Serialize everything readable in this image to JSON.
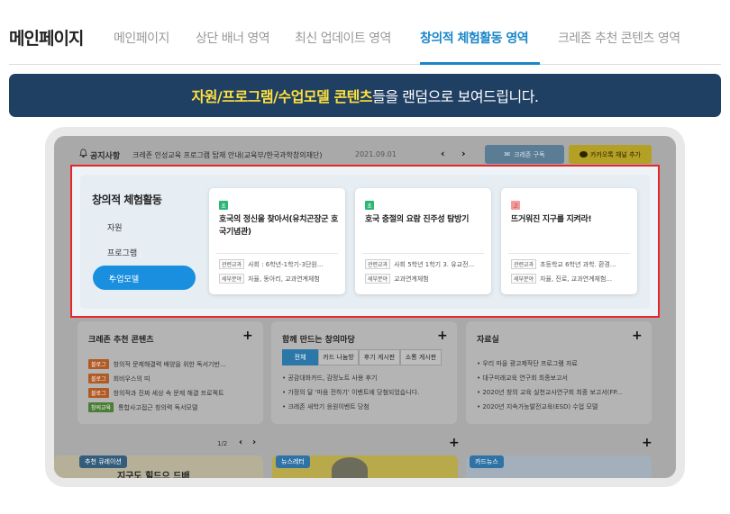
{
  "header": {
    "page_title": "메인페이지",
    "tabs": [
      {
        "label": "메인페이지"
      },
      {
        "label": "상단 배너 영역"
      },
      {
        "label": "최신 업데이트 영역"
      },
      {
        "label": "창의적 체험활동 영역"
      },
      {
        "label": "크레존 추천 콘텐츠 영역"
      }
    ],
    "active_tab_index": 3,
    "accent_color": "#1a86c8"
  },
  "banner": {
    "highlight": "자원/프로그램/수업모델 콘텐츠",
    "rest": "들을 랜덤으로 보여드립니다.",
    "bg_color": "#1f3f63",
    "highlight_color": "#ffe03d"
  },
  "preview": {
    "notice": {
      "label": "공지사항",
      "icon": "bell-icon",
      "text": "크레존 인성교육 프로그램 탑재 안내(교육부/한국과학창의재단)",
      "date": "2021.09.01",
      "subscribe_label": "크레존 구독",
      "kakao_label": "카카오톡 채널 추가"
    },
    "highlight_border_color": "#e8262a",
    "creative": {
      "title": "창의적 체험활동",
      "menu": [
        {
          "label": "자원"
        },
        {
          "label": "프로그램"
        },
        {
          "label": "수업모델"
        }
      ],
      "active_menu_index": 2,
      "cards": [
        {
          "badge": "초",
          "badge_color": "#2bb673",
          "title": "호국의 정신을 찾아서(유치곤장군 호국기념관)",
          "meta": [
            {
              "key": "관련교과",
              "value": "사회 : 6학년-1학기-3단원..."
            },
            {
              "key": "세부분야",
              "value": "자율, 동아리, 교과연계체험"
            }
          ]
        },
        {
          "badge": "초",
          "badge_color": "#2bb673",
          "title": "호국 충절의 요람 진주성 탐방기",
          "meta": [
            {
              "key": "관련교과",
              "value": "사회 5학년 1학기 3. 유교전..."
            },
            {
              "key": "세부분야",
              "value": "교과연계체험"
            }
          ]
        },
        {
          "badge": "고",
          "badge_color": "#f39b9b",
          "title": "뜨거워진 지구를 지켜라!",
          "meta": [
            {
              "key": "관련교과",
              "value": "초등학교 6학년 과학. 환경..."
            },
            {
              "key": "세부분야",
              "value": "자율, 진로, 교과연계체험..."
            }
          ]
        }
      ]
    },
    "recommend": {
      "title": "크레존 추천 콘텐츠",
      "items": [
        {
          "tag": "블로그",
          "text": "창의적 문제해결력 배양을 위한 독서기반..."
        },
        {
          "tag": "블로그",
          "text": "회비우스의 띠"
        },
        {
          "tag": "블로그",
          "text": "창의적과 진짜 세상 속 문제 해결 프로젝트"
        },
        {
          "tag": "창의교육",
          "text": "통합사고접근 창의력 독서모델"
        }
      ],
      "pager": "1/2"
    },
    "madang": {
      "title": "함께 만드는 창의마당",
      "tabs": [
        {
          "label": "전체"
        },
        {
          "label": "카드 나눔방"
        },
        {
          "label": "후기 게시판"
        },
        {
          "label": "소통 게시판"
        }
      ],
      "items": [
        {
          "text": "• 공감대화카드, 감정노트 사용 후기"
        },
        {
          "text": "• 가정의 달 '마음 전하기' 이벤트에 당첨되었습니다."
        },
        {
          "text": "• 크레존 새학기 응원이벤트 당첨"
        }
      ]
    },
    "resources": {
      "title": "자료실",
      "items": [
        {
          "text": "• 우리 마을 광고제작단 프로그램 자료"
        },
        {
          "text": "• 대구미래교육 연구회 최종보고서"
        },
        {
          "text": "• 2020년 창의 교육 실천교사연구회 최종 보고서(FP..."
        },
        {
          "text": "• 2020년 지속가능발전교육(ESD) 수업 모델"
        }
      ]
    },
    "bottom": {
      "curation_label": "추천 큐레이션",
      "curation_heading": "지구도 힐드으 드배",
      "newsletter_label": "뉴스레터",
      "cardnews_label": "카드뉴스"
    }
  }
}
